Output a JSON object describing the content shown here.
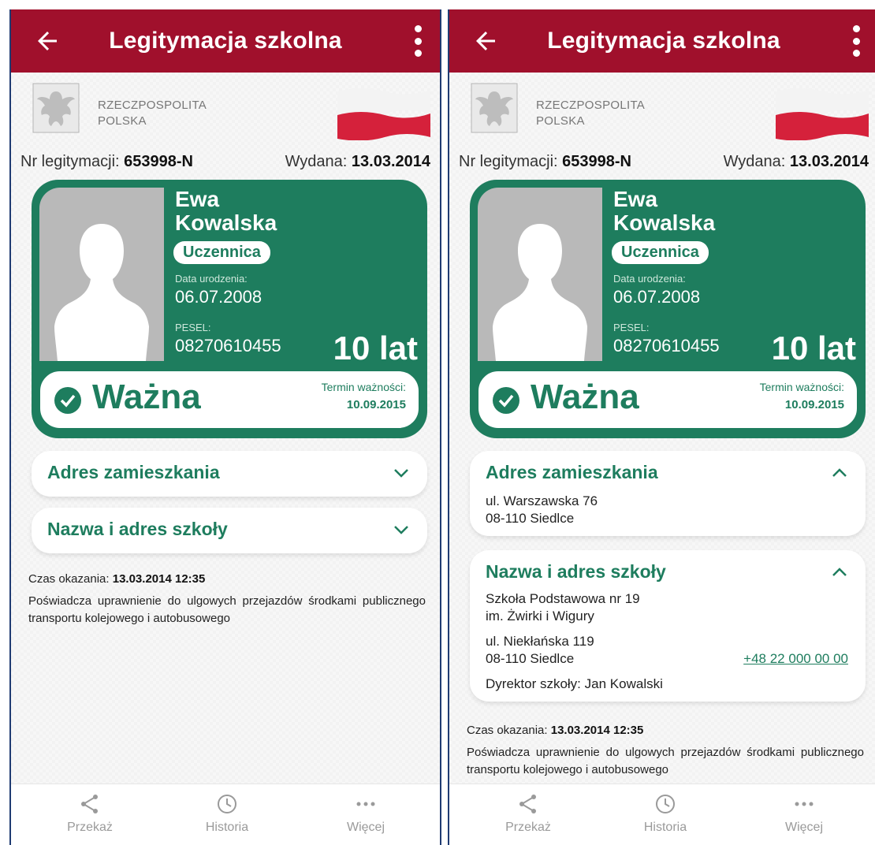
{
  "app": {
    "title": "Legitymacja szkolna",
    "state_name_line1": "RZECZPOSPOLITA",
    "state_name_line2": "POLSKA"
  },
  "colors": {
    "brand_red": "#a0102c",
    "card_green": "#1e7d5e"
  },
  "icons": {
    "back": "arrow-left-icon",
    "menu": "kebab-menu-icon",
    "share": "share-icon",
    "history": "history-icon",
    "more": "more-dots-icon",
    "check": "check-circle-icon",
    "chevron_down": "chevron-down-icon",
    "chevron_up": "chevron-up-icon"
  },
  "id": {
    "number_label": "Nr legitymacji:",
    "number_value": "653998-N",
    "issued_label": "Wydana:",
    "issued_value": "13.03.2014"
  },
  "person": {
    "first_name": "Ewa",
    "last_name": "Kowalska",
    "role": "Uczennica",
    "dob_label": "Data urodzenia:",
    "dob_value": "06.07.2008",
    "pesel_label": "PESEL:",
    "pesel_value": "08270610455",
    "age": "10 lat"
  },
  "validity": {
    "status": "Ważna",
    "expiry_label": "Termin ważności:",
    "expiry_date": "10.09.2015"
  },
  "address": {
    "title": "Adres zamieszkania",
    "line1": "ul. Warszawska 76",
    "line2": "08-110 Siedlce"
  },
  "school": {
    "title": "Nazwa i adres szkoły",
    "name_line1": "Szkoła Podstawowa nr 19",
    "name_line2": "im. Żwirki i Wigury",
    "street": "ul. Niekłańska 119",
    "city": "08-110 Siedlce",
    "phone": "+48 22 000 00 00",
    "director_label": "Dyrektor szkoły:",
    "director_name": "Jan Kowalski"
  },
  "meta": {
    "shown_label": "Czas okazania:",
    "shown_value": "13.03.2014 12:35",
    "description": "Poświadcza uprawnienie do ulgowych przejazdów środkami publicznego transportu kolejowego i autobusowego"
  },
  "nav": {
    "share": "Przekaż",
    "history": "Historia",
    "more": "Więcej"
  }
}
